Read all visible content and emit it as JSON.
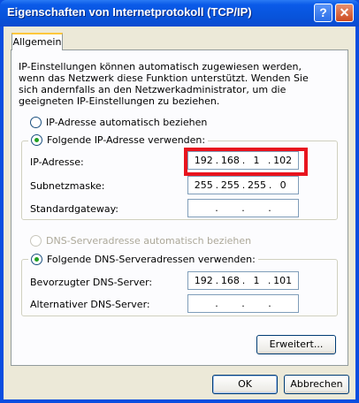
{
  "window": {
    "title": "Eigenschaften von Internetprotokoll (TCP/IP)",
    "help_glyph": "?",
    "close_glyph": "✕"
  },
  "tabs": [
    {
      "label": "Allgemein"
    }
  ],
  "intro_text": "IP-Einstellungen können automatisch zugewiesen werden, wenn das Netzwerk diese Funktion unterstützt. Wenden Sie sich andernfalls an den Netzwerkadministrator, um die geeigneten IP-Einstellungen zu beziehen.",
  "ip_section": {
    "auto_label": "IP-Adresse automatisch beziehen",
    "manual_label": "Folgende IP-Adresse verwenden:",
    "selected": "manual",
    "fields": [
      {
        "label": "IP-Adresse:",
        "octets": [
          "192",
          "168",
          "1",
          "102"
        ]
      },
      {
        "label": "Subnetzmaske:",
        "octets": [
          "255",
          "255",
          "255",
          "0"
        ]
      },
      {
        "label": "Standardgateway:",
        "octets": [
          "",
          "",
          "",
          ""
        ]
      }
    ]
  },
  "dns_section": {
    "auto_label": "DNS-Serveradresse automatisch beziehen",
    "manual_label": "Folgende DNS-Serveradressen verwenden:",
    "selected": "manual",
    "auto_disabled": true,
    "fields": [
      {
        "label": "Bevorzugter DNS-Server:",
        "octets": [
          "192",
          "168",
          "1",
          "101"
        ]
      },
      {
        "label": "Alternativer DNS-Server:",
        "octets": [
          "",
          "",
          "",
          ""
        ]
      }
    ]
  },
  "buttons": {
    "advanced": "Erweitert...",
    "ok": "OK",
    "cancel": "Abbrechen"
  },
  "colors": {
    "titlebar": "#0a5ae8",
    "highlight": "#e8141e",
    "radio_dot": "#21a121"
  }
}
